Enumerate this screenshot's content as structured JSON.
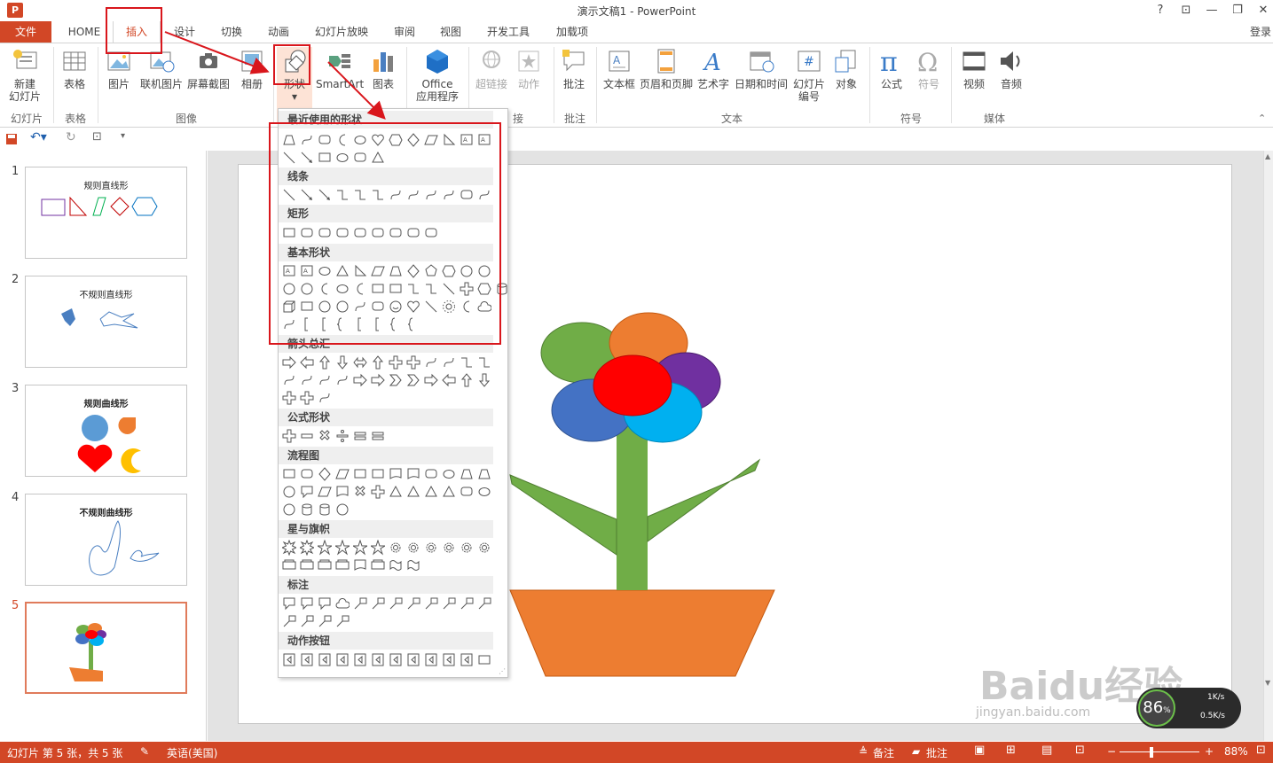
{
  "titlebar": {
    "title": "演示文稿1 - PowerPoint",
    "help": "?",
    "ribbon_opts": "⊡",
    "minimize": "—",
    "restore": "❐",
    "close": "✕"
  },
  "tabs": [
    "文件",
    "HOME",
    "插入",
    "设计",
    "切换",
    "动画",
    "幻灯片放映",
    "审阅",
    "视图",
    "开发工具",
    "加载项"
  ],
  "active_tab": "插入",
  "login": "登录",
  "ribbon": {
    "buttons": {
      "new_slide": [
        "新建",
        "幻灯片"
      ],
      "table": "表格",
      "picture": "图片",
      "online_picture": "联机图片",
      "screenshot": "屏幕截图",
      "album": "相册",
      "shapes": "形状",
      "smartart": "SmartArt",
      "chart": "图表",
      "office_apps": [
        "Office",
        "应用程序"
      ],
      "hyperlink": "超链接",
      "action": "动作",
      "comment": "批注",
      "textbox": "文本框",
      "header_footer": "页眉和页脚",
      "wordart": "艺术字",
      "datetime": "日期和时间",
      "slide_number": [
        "幻灯片",
        "编号"
      ],
      "object": "对象",
      "equation": "公式",
      "symbol": "符号",
      "video": "视频",
      "audio": "音频"
    },
    "groups": {
      "slides": "幻灯片",
      "tables": "表格",
      "images": "图像",
      "links_tail": "接",
      "comments": "批注",
      "text": "文本",
      "symbols": "符号",
      "media": "媒体"
    }
  },
  "shapes_panel": {
    "sections": [
      "最近使用的形状",
      "线条",
      "矩形",
      "基本形状",
      "箭头总汇",
      "公式形状",
      "流程图",
      "星与旗帜",
      "标注",
      "动作按钮"
    ]
  },
  "slides": [
    {
      "num": "1",
      "title": "规则直线形"
    },
    {
      "num": "2",
      "title": "不规则直线形"
    },
    {
      "num": "3",
      "title": "规则曲线形"
    },
    {
      "num": "4",
      "title": "不规则曲线形"
    },
    {
      "num": "5",
      "title": ""
    }
  ],
  "statusbar": {
    "slide_info": "幻灯片 第 5 张，共 5 张",
    "language": "英语(美国)",
    "notes": "备注",
    "comments": "批注",
    "zoom": "88%"
  },
  "net_widget": {
    "percent": "86",
    "unit": "%",
    "up": "1K/s",
    "down": "0.5K/s"
  },
  "watermark": {
    "brand": "Baidu经验",
    "url": "jingyan.baidu.com"
  },
  "colors": {
    "accent": "#d24726",
    "highlight": "#d9161c"
  }
}
